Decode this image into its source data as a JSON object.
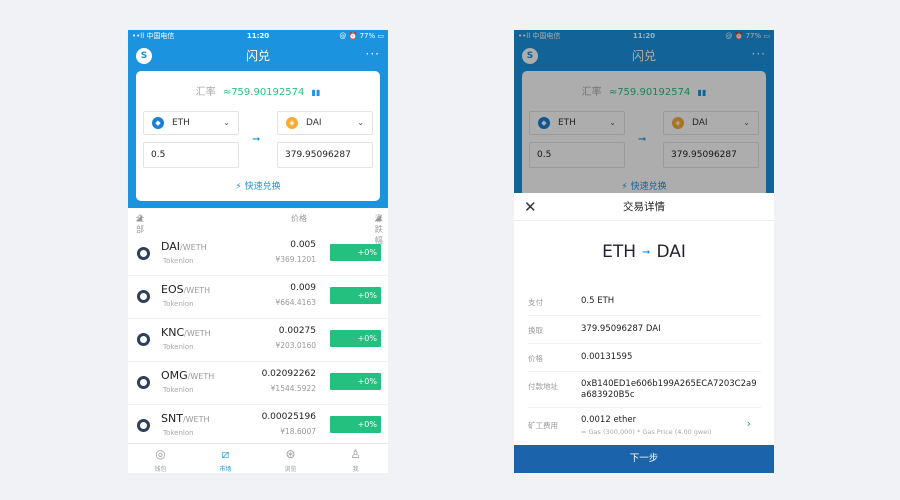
{
  "statusbar": {
    "carrier": "••ll 中国电信 ",
    "time": "11:20",
    "battery": "@ ⏰ 77% ▭"
  },
  "app": {
    "title": "闪兑",
    "more": "···",
    "logo": "S"
  },
  "swap": {
    "rate_label": "汇率",
    "rate_value": "≈759.90192574",
    "from_token": "ETH",
    "to_token": "DAI",
    "from_amount": "0.5",
    "to_amount": "379.95096287",
    "quick_swap": "快速兑换"
  },
  "list": {
    "headers": {
      "all": "全部",
      "price": "价格",
      "change": "涨跌幅"
    },
    "rows": [
      {
        "base": "DAI",
        "quote": "/WETH",
        "source": "Tokenlon",
        "price": "0.005",
        "cny": "¥369.1201",
        "change": "+0%"
      },
      {
        "base": "EOS",
        "quote": "/WETH",
        "source": "Tokenlon",
        "price": "0.009",
        "cny": "¥664.4163",
        "change": "+0%"
      },
      {
        "base": "KNC",
        "quote": "/WETH",
        "source": "Tokenlon",
        "price": "0.00275",
        "cny": "¥203.0160",
        "change": "+0%"
      },
      {
        "base": "OMG",
        "quote": "/WETH",
        "source": "Tokenlon",
        "price": "0.02092262",
        "cny": "¥1544.5922",
        "change": "+0%"
      },
      {
        "base": "SNT",
        "quote": "/WETH",
        "source": "Tokenlon",
        "price": "0.00025196",
        "cny": "¥18.6007",
        "change": "+0%"
      }
    ]
  },
  "tabs": [
    {
      "label": "钱包",
      "icon": "wallet-icon"
    },
    {
      "label": "市场",
      "icon": "market-chart-icon"
    },
    {
      "label": "浏览",
      "icon": "browse-icon"
    },
    {
      "label": "我",
      "icon": "profile-icon"
    }
  ],
  "detail": {
    "title": "交易详情",
    "pair_from": "ETH",
    "pair_to": "DAI",
    "pay_label": "支付",
    "pay_value": "0.5 ETH",
    "receive_label": "换取",
    "receive_value": "379.95096287 DAI",
    "price_label": "价格",
    "price_value": "0.00131595",
    "address_label": "付款地址",
    "address_value": "0xB140ED1e606b199A265ECA7203C2a9a683920B5c",
    "fee_label": "矿工费用",
    "fee_value": "0.0012 ether",
    "fee_sub": "= Gas (300,000) * Gas Price (4.00 gwei)",
    "next": "下一步"
  },
  "colors": {
    "brand": "#1b93df",
    "up": "#23c07f",
    "rate": "#2ebd85",
    "next": "#1b63aa"
  }
}
